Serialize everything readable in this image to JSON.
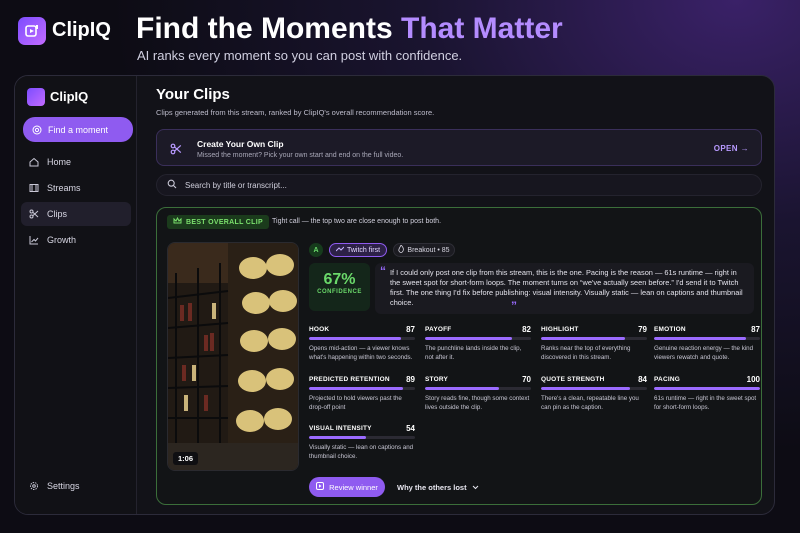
{
  "brand": {
    "name": "ClipIQ"
  },
  "hero": {
    "title_main": "Find the Moments ",
    "title_accent": "That Matter",
    "subtitle": "AI ranks every moment so you can post with confidence."
  },
  "sidebar": {
    "logo": "ClipIQ",
    "find_button": "Find a moment",
    "items": [
      {
        "label": "Home",
        "icon": "home-icon"
      },
      {
        "label": "Streams",
        "icon": "film-icon"
      },
      {
        "label": "Clips",
        "icon": "scissors-icon",
        "active": true
      },
      {
        "label": "Growth",
        "icon": "chart-icon"
      }
    ],
    "settings": "Settings"
  },
  "main": {
    "title": "Your Clips",
    "subtitle": "Clips generated from this stream, ranked by ClipIQ's overall recommendation score.",
    "create": {
      "title": "Create Your Own Clip",
      "subtitle": "Missed the moment? Pick your own start and end on the full video.",
      "open": "OPEN →"
    },
    "search": {
      "placeholder": "Search by title or transcript..."
    }
  },
  "card": {
    "badge": "BEST OVERALL CLIP",
    "tight_call": "Tight call — the top two are close enough to post both.",
    "duration": "1:06",
    "grade": "A",
    "platform": "Twitch first",
    "breakout": "Breakout • 85",
    "confidence_value": "67%",
    "confidence_label": "CONFIDENCE",
    "quote": "If I could only post one clip from this stream, this is the one. Pacing is the reason — 61s runtime — right in the sweet spot for short-form loops. The moment turns on “we've actually seen before.” I'd send it to Twitch first. The one thing I'd fix before publishing: visual intensity. Visually static — lean on captions and thumbnail choice.",
    "metrics": [
      {
        "name": "HOOK",
        "value": 87,
        "desc": "Opens mid-action — a viewer knows what's happening within two seconds."
      },
      {
        "name": "PAYOFF",
        "value": 82,
        "desc": "The punchline lands inside the clip, not after it."
      },
      {
        "name": "HIGHLIGHT",
        "value": 79,
        "desc": "Ranks near the top of everything discovered in this stream."
      },
      {
        "name": "EMOTION",
        "value": 87,
        "desc": "Genuine reaction energy — the kind viewers rewatch and quote."
      },
      {
        "name": "PREDICTED RETENTION",
        "value": 89,
        "desc": "Projected to hold viewers past the drop-off point"
      },
      {
        "name": "STORY",
        "value": 70,
        "desc": "Story reads fine, though some context lives outside the clip."
      },
      {
        "name": "QUOTE STRENGTH",
        "value": 84,
        "desc": "There's a clean, repeatable line you can pin as the caption."
      },
      {
        "name": "PACING",
        "value": 100,
        "desc": "61s runtime — right in the sweet spot for short-form loops."
      },
      {
        "name": "VISUAL INTENSITY",
        "value": 54,
        "desc": "Visually static — lean on captions and thumbnail choice."
      }
    ],
    "review_button": "Review winner",
    "others_button": "Why the others lost"
  },
  "colors": {
    "accent": "#8f5bf0",
    "success": "#6ad96a",
    "bg": "#121218"
  }
}
